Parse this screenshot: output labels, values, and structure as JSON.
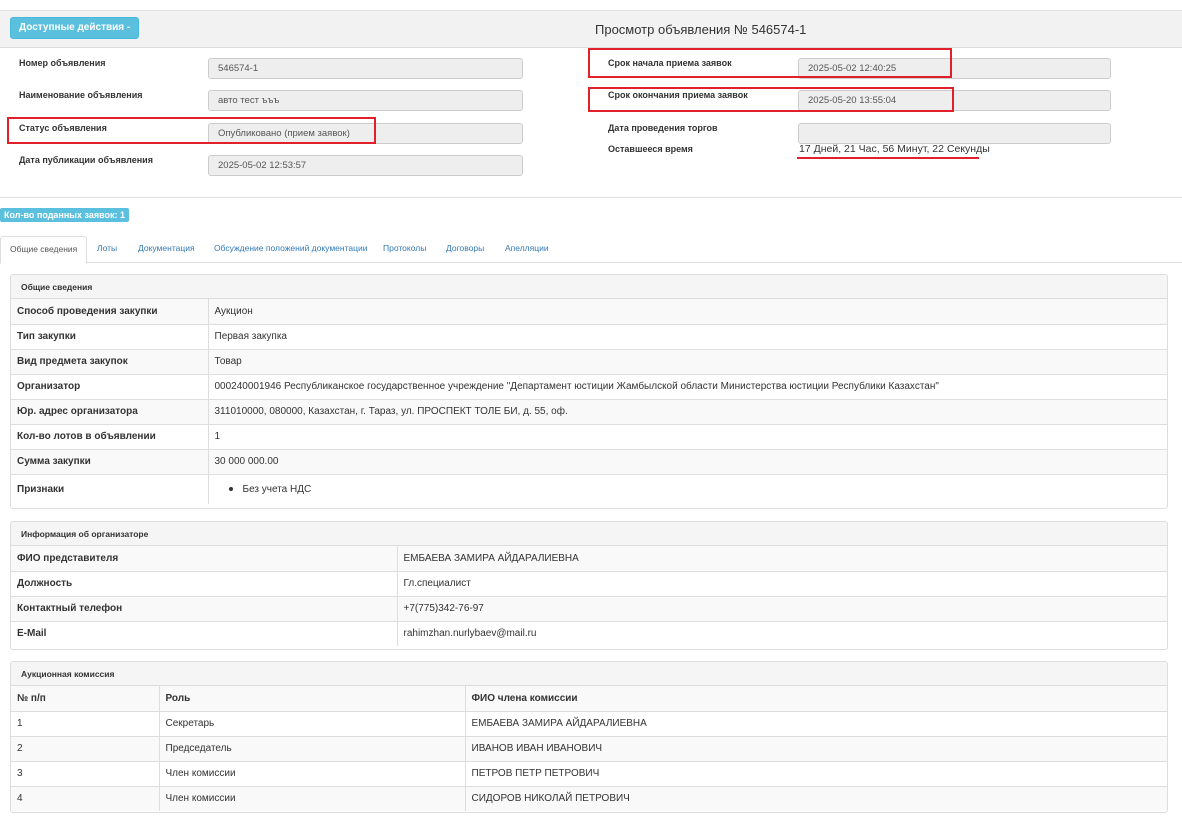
{
  "header": {
    "actions_label": "Доступные действия -",
    "title": "Просмотр объявления № 546574-1"
  },
  "form": {
    "left": [
      {
        "label": "Номер объявления",
        "value": "546574-1"
      },
      {
        "label": "Наименование объявления",
        "value": "авто тест ъъъ"
      },
      {
        "label": "Статус объявления",
        "value": "Опубликовано (прием заявок)"
      },
      {
        "label": "Дата публикации объявления",
        "value": "2025-05-02 12:53:57"
      }
    ],
    "right": [
      {
        "label": "Срок начала приема заявок",
        "value": "2025-05-02 12:40:25"
      },
      {
        "label": "Срок окончания приема заявок",
        "value": "2025-05-20 13:55:04"
      },
      {
        "label": "Дата проведения торгов",
        "value": ""
      },
      {
        "label": "Оставшееся время",
        "value": "17 Дней, 21 Час, 56 Минут, 22 Секунды"
      }
    ]
  },
  "count_badge": "Кол-во поданных заявок: 1",
  "tabs": [
    "Общие сведения",
    "Лоты",
    "Документация",
    "Обсуждение положений документации",
    "Протоколы",
    "Договоры",
    "Апелляции"
  ],
  "general": {
    "title": "Общие сведения",
    "rows": [
      {
        "label": "Способ проведения закупки",
        "value": "Аукцион"
      },
      {
        "label": "Тип закупки",
        "value": "Первая закупка"
      },
      {
        "label": "Вид предмета закупок",
        "value": "Товар"
      },
      {
        "label": "Организатор",
        "value": "000240001946 Республиканское государственное учреждение \"Департамент юстиции Жамбылской области Министерства юстиции Республики Казахстан\""
      },
      {
        "label": "Юр. адрес организатора",
        "value": "311010000, 080000, Казахстан, г. Тараз, ул. ПРОСПЕКТ ТОЛЕ БИ, д. 55, оф."
      },
      {
        "label": "Кол-во лотов в объявлении",
        "value": "1"
      },
      {
        "label": "Сумма закупки",
        "value": "30 000 000.00"
      },
      {
        "label": "Признаки",
        "value": "Без учета НДС"
      }
    ]
  },
  "organizer": {
    "title": "Информация об организаторе",
    "rows": [
      {
        "label": "ФИО представителя",
        "value": "ЕМБАЕВА ЗАМИРА АЙДАРАЛИЕВНА"
      },
      {
        "label": "Должность",
        "value": "Гл.специалист"
      },
      {
        "label": "Контактный телефон",
        "value": "+7(775)342-76-97"
      },
      {
        "label": "E-Mail",
        "value": "rahimzhan.nurlybaev@mail.ru"
      }
    ]
  },
  "commission": {
    "title": "Аукционная комиссия",
    "headers": [
      "№ п/п",
      "Роль",
      "ФИО члена комиссии"
    ],
    "rows": [
      {
        "num": "1",
        "role": "Секретарь",
        "name": "ЕМБАЕВА ЗАМИРА АЙДАРАЛИЕВНА"
      },
      {
        "num": "2",
        "role": "Председатель",
        "name": "ИВАНОВ ИВАН ИВАНОВИЧ"
      },
      {
        "num": "3",
        "role": "Член комиссии",
        "name": "ПЕТРОВ ПЕТР ПЕТРОВИЧ"
      },
      {
        "num": "4",
        "role": "Член комиссии",
        "name": "СИДОРОВ НИКОЛАЙ ПЕТРОВИЧ"
      }
    ]
  },
  "colors": {
    "accent": "#5bc0de",
    "link": "#337ab7",
    "highlight": "#e0202a"
  }
}
